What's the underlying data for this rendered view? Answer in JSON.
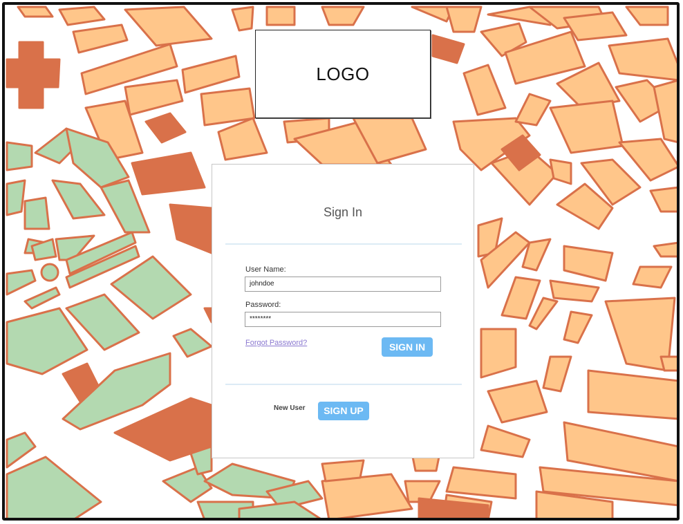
{
  "logo": {
    "text": "LOGO"
  },
  "signin_panel": {
    "title": "Sign In",
    "username_label": "User Name:",
    "username_value": "johndoe",
    "password_label": "Password:",
    "password_value": "********",
    "forgot_link": "Forgot Password?",
    "signin_button": "SIGN IN",
    "new_user_label": "New User",
    "signup_button": "SIGN UP"
  },
  "colors": {
    "block_orange": "#ffc68a",
    "block_dark": "#d9714a",
    "park_green": "#b3d9b0",
    "outline": "#d9714a",
    "button_blue": "#6cb9f3"
  }
}
